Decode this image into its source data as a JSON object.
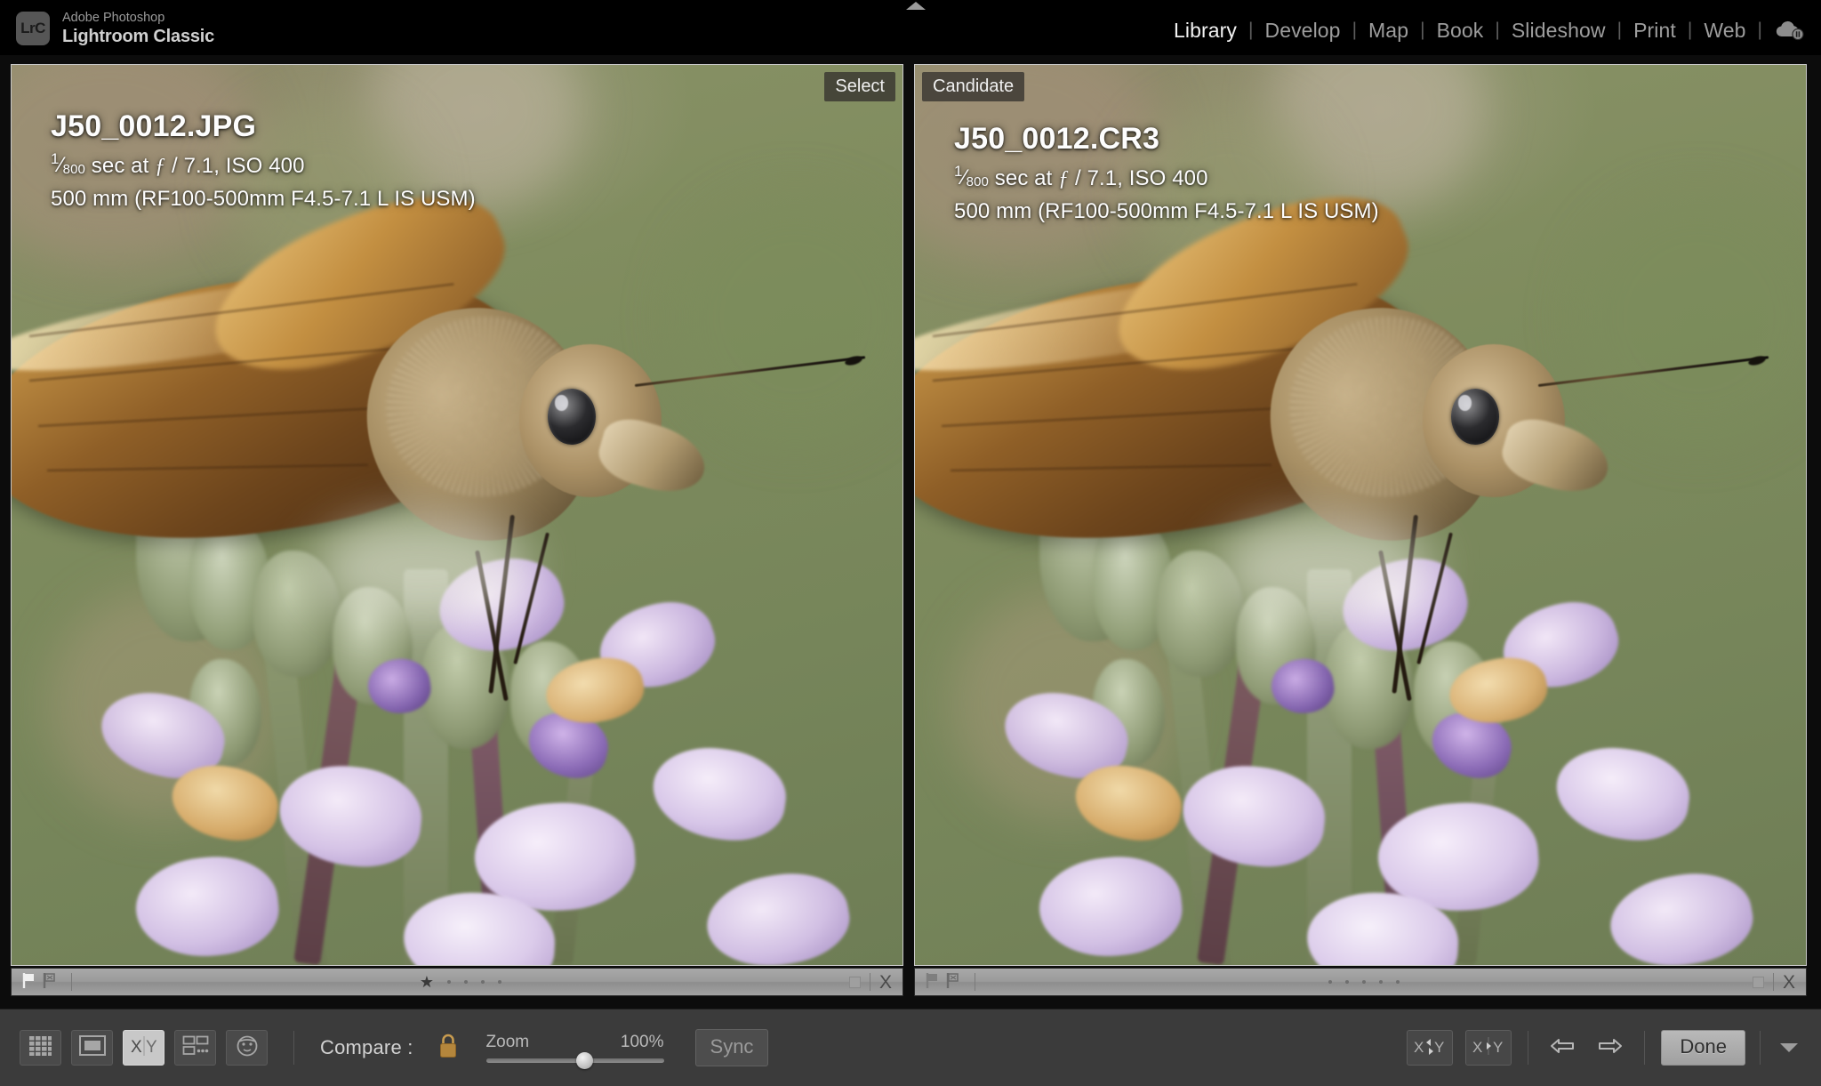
{
  "app": {
    "logo_text": "LrC",
    "brand_line1": "Adobe Photoshop",
    "brand_line2": "Lightroom Classic"
  },
  "modules": {
    "items": [
      {
        "label": "Library",
        "active": true
      },
      {
        "label": "Develop",
        "active": false
      },
      {
        "label": "Map",
        "active": false
      },
      {
        "label": "Book",
        "active": false
      },
      {
        "label": "Slideshow",
        "active": false
      },
      {
        "label": "Print",
        "active": false
      },
      {
        "label": "Web",
        "active": false
      }
    ],
    "separator": "|",
    "cloud_icon": "cloud-sync-paused-icon"
  },
  "compare": {
    "select": {
      "badge": "Select",
      "filename": "J50_0012.JPG",
      "shutter_numerator": "1",
      "shutter_denominator": "800",
      "exposure_rest": " sec at ",
      "aperture_symbol": "ƒ",
      "aperture": " / 7.1, ISO 400",
      "lens_line": "500 mm (RF100-500mm F4.5-7.1 L IS USM)",
      "rating_stars": 1,
      "rating_total": 5,
      "flag_icon": "flag-pick-icon",
      "reject_icon": "flag-reject-icon",
      "color_label_icon": "color-label-swatch",
      "reject_x": "X"
    },
    "candidate": {
      "badge": "Candidate",
      "filename": "J50_0012.CR3",
      "shutter_numerator": "1",
      "shutter_denominator": "800",
      "exposure_rest": " sec at ",
      "aperture_symbol": "ƒ",
      "aperture": " / 7.1, ISO 400",
      "lens_line": "500 mm (RF100-500mm F4.5-7.1 L IS USM)",
      "rating_stars": 0,
      "rating_total": 5,
      "flag_icon": "flag-pick-icon",
      "reject_icon": "flag-reject-icon",
      "color_label_icon": "color-label-swatch",
      "reject_x": "X"
    }
  },
  "toolbar": {
    "view_modes": [
      {
        "name": "grid-view-icon",
        "active": false
      },
      {
        "name": "loupe-view-icon",
        "active": false
      },
      {
        "name": "compare-view-icon",
        "active": true
      },
      {
        "name": "survey-view-icon",
        "active": false
      },
      {
        "name": "people-view-icon",
        "active": false
      }
    ],
    "compare_label": "Compare :",
    "lock_icon": "padlock-closed-icon",
    "zoom_label": "Zoom",
    "zoom_value": "100%",
    "zoom_slider_percent": 55,
    "sync_label": "Sync",
    "swap_button_icon": "swap-xy-icon",
    "make_select_icon": "make-select-icon",
    "prev_icon": "arrow-left-icon",
    "next_icon": "arrow-right-icon",
    "done_label": "Done",
    "toolbar_caret_icon": "chevron-down-icon"
  },
  "panels": {
    "left_toggle_icon": "panel-toggle-left-icon",
    "right_toggle_icon": "panel-toggle-right-icon",
    "top_toggle_icon": "panel-toggle-top-icon"
  },
  "colors": {
    "background": "#000000",
    "photo_green": "#7e8c5f",
    "toolbar_bg": "#3b3b3b",
    "infobar_bg": "#9a9a9a",
    "module_active": "#f2f2f2",
    "module_idle": "#9d9d9d"
  }
}
